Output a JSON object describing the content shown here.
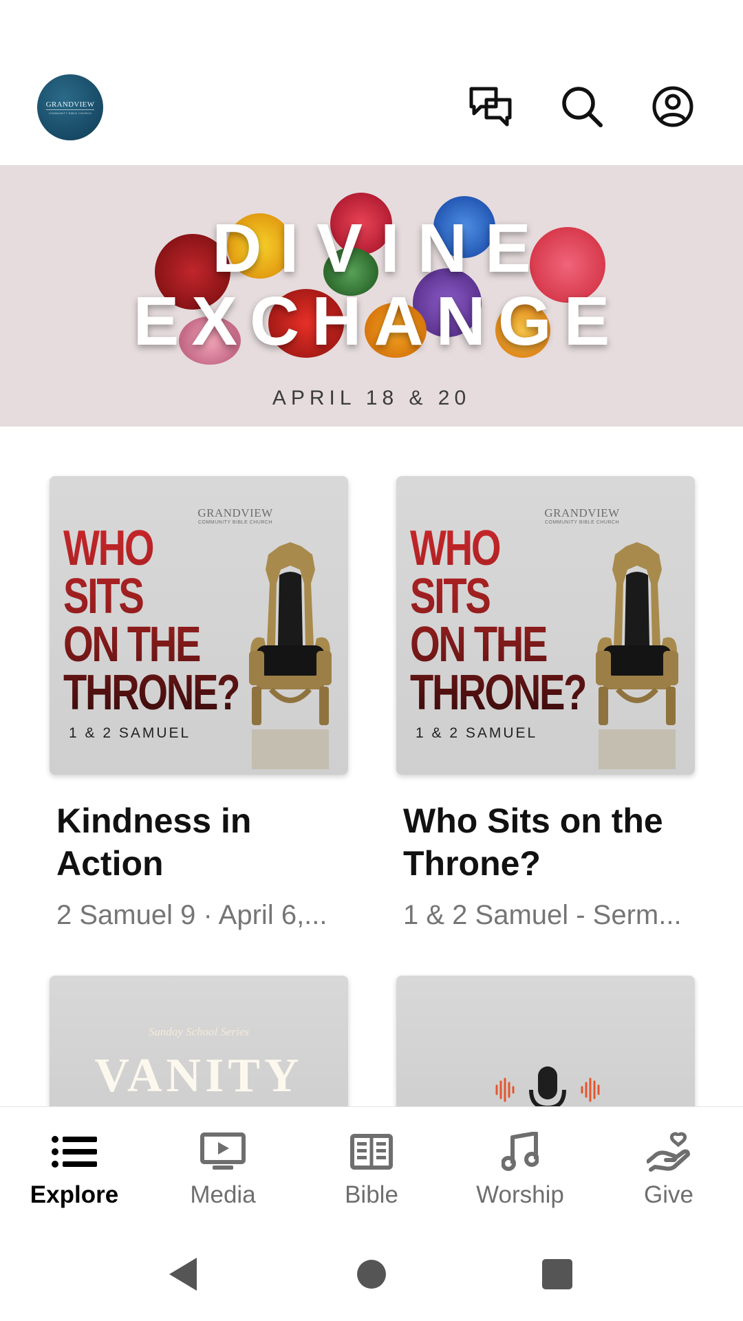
{
  "header": {
    "logo": {
      "name": "GRANDVIEW",
      "subtitle": "COMMUNITY BIBLE CHURCH"
    },
    "icons": [
      "messages-icon",
      "search-icon",
      "profile-icon"
    ]
  },
  "hero": {
    "title_line1": "DIVINE",
    "title_line2": "EXCHANGE",
    "date": "APRIL 18 & 20"
  },
  "cards": [
    {
      "thumb": {
        "church": "GRANDVIEW",
        "church_sub": "COMMUNITY BIBLE CHURCH",
        "series": [
          "WHO",
          "SITS",
          "ON THE",
          "THRONE?"
        ],
        "series_sub": "1 & 2 SAMUEL"
      },
      "title": "Kindness in Action",
      "meta": "2 Samuel 9 · April 6,..."
    },
    {
      "thumb": {
        "church": "GRANDVIEW",
        "church_sub": "COMMUNITY BIBLE CHURCH",
        "series": [
          "WHO",
          "SITS",
          "ON THE",
          "THRONE?"
        ],
        "series_sub": "1 & 2 SAMUEL"
      },
      "title": "Who Sits on the Throne?",
      "meta": "1 & 2 Samuel - Serm..."
    },
    {
      "thumb": {
        "kicker": "Sunday School Series",
        "title": "VANITY"
      }
    },
    {
      "thumb": {
        "icon": "microphone-icon"
      }
    }
  ],
  "bottom_nav": {
    "active": "Explore",
    "items": [
      {
        "label": "Explore",
        "icon": "list-icon"
      },
      {
        "label": "Media",
        "icon": "tv-play-icon"
      },
      {
        "label": "Bible",
        "icon": "bible-book-icon"
      },
      {
        "label": "Worship",
        "icon": "music-note-icon"
      },
      {
        "label": "Give",
        "icon": "give-hand-heart-icon"
      }
    ]
  },
  "system_nav": [
    "back-icon",
    "home-icon",
    "recents-icon"
  ],
  "colors": {
    "hero_bg": "#e6dcdd",
    "series_red": "#b8232a",
    "active_label": "#000000",
    "inactive_label": "#6e6e6e",
    "mic_wave": "#e2562f"
  }
}
